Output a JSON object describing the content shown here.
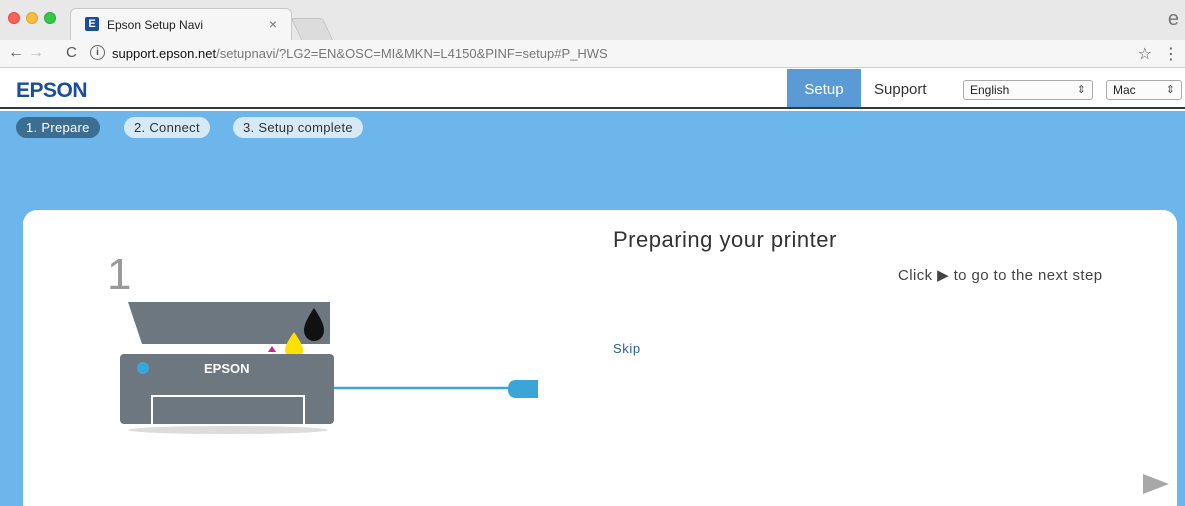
{
  "browser": {
    "tab_title": "Epson Setup Navi",
    "tab_favicon": "E",
    "tab_close": "×",
    "url_host": "support.epson.net",
    "url_path": "/setupnavi/?LG2=EN&OSC=MI&MKN=L4150&PINF=setup#P_HWS",
    "icons": [
      "back-arrow-icon",
      "forward-arrow-icon",
      "reload-icon",
      "info-icon",
      "star-icon",
      "menu-icon",
      "profile-icon"
    ]
  },
  "header": {
    "logo": "EPSON",
    "nav": {
      "setup": "Setup",
      "support": "Support"
    },
    "language_select": "English",
    "os_select": "Mac",
    "colors": {
      "logo": "#1a4e9c",
      "active_nav": "#5b9bd5"
    }
  },
  "steps": [
    {
      "label": "1. Prepare",
      "active": true
    },
    {
      "label": "2. Connect",
      "active": false
    },
    {
      "label": "3. Setup complete",
      "active": false
    }
  ],
  "main": {
    "step_number": "1",
    "title": "Preparing your printer",
    "hint": "Click ▶ to go to the next step",
    "skip": "Skip",
    "printer_brand": "EPSON",
    "colors": {
      "stage": "#6cb6ec",
      "cable": "#3aa6d8",
      "ink_yellow": "#ffe000",
      "ink_black": "#111111"
    }
  }
}
